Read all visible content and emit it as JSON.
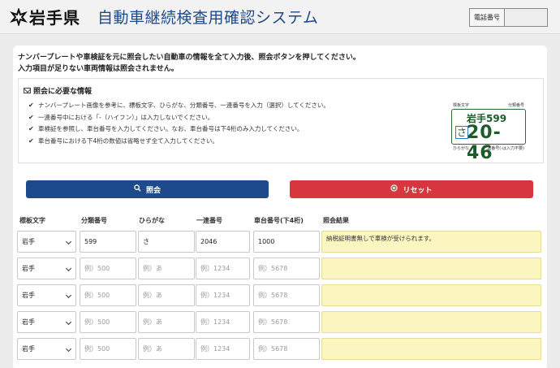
{
  "header": {
    "logo_text": "岩手県",
    "title": "自動車継続検査用確認システム",
    "phone_label": "電話番号",
    "phone_value": ""
  },
  "intro": {
    "line1": "ナンバープレートや車検証を元に照会したい自動車の情報を全て入力後、照会ボタンを押してください。",
    "line2": "入力項目が足りない車両情報は照会されません。"
  },
  "info": {
    "title": "照会に必要な情報",
    "items": [
      "ナンバープレート画像を参考に、標板文字、ひらがな、分類番号、一連番号を入力（選択）してください。",
      "一連番号中における「-（ハイフン）」は入力しないでください。",
      "車検証を参照し、車台番号を入力してください。なお、車台番号は下4桁のみ入力してください。",
      "車台番号における下4桁の数値は省略せず全て入力してください。"
    ],
    "plate": {
      "label_top_left": "標板文字",
      "label_top_right": "分類番号",
      "upper": "岩手599",
      "hiragana": "さ",
      "number": "20-46",
      "label_bottom_left": "ひらがな",
      "label_bottom_right": "一連番号(-は入力不要)"
    }
  },
  "buttons": {
    "search_label": "照会",
    "reset_label": "リセット"
  },
  "table": {
    "headers": [
      "標板文字",
      "分類番号",
      "ひらがな",
      "一連番号",
      "車台番号(下4桁)",
      "照会結果"
    ],
    "placeholders": {
      "class_no": "例）500",
      "hiragana": "例）あ",
      "serial": "例）1234",
      "chassis": "例）5678"
    },
    "rows": [
      {
        "region": "岩手",
        "class_no": "599",
        "hiragana": "さ",
        "serial": "2046",
        "chassis": "1000",
        "result": "納税証明書無しで車検が受けられます。"
      },
      {
        "region": "岩手",
        "class_no": "",
        "hiragana": "",
        "serial": "",
        "chassis": "",
        "result": ""
      },
      {
        "region": "岩手",
        "class_no": "",
        "hiragana": "",
        "serial": "",
        "chassis": "",
        "result": ""
      },
      {
        "region": "岩手",
        "class_no": "",
        "hiragana": "",
        "serial": "",
        "chassis": "",
        "result": ""
      },
      {
        "region": "岩手",
        "class_no": "",
        "hiragana": "",
        "serial": "",
        "chassis": "",
        "result": ""
      }
    ]
  },
  "colors": {
    "primary": "#1d4a8a",
    "danger": "#d7363f",
    "result_bg": "#fbf5c0"
  }
}
